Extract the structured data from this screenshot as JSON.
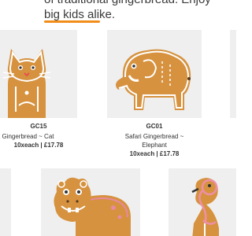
{
  "intro": {
    "line1": "of traditional gingerbread. Enjoy",
    "line2": "big kids alike."
  },
  "colors": {
    "accent": "#f28c1b",
    "card_bg": "#efefef",
    "text": "#333333",
    "gingerbread": "#d6923f",
    "icing": "#ffffff"
  },
  "products": [
    {
      "sku": "GC15",
      "name": "t Gingerbread ~ Cat",
      "price": "10xeach | £17.78",
      "icon": "gingerbread-cat-icon"
    },
    {
      "sku": "GC01",
      "name_line1": "Safari Gingerbread ~",
      "name_line2": "Elephant",
      "price": "10xeach | £17.78",
      "icon": "gingerbread-elephant-icon"
    },
    {
      "icon": "gingerbread-hippo-icon"
    },
    {
      "icon": "gingerbread-flamingo-icon"
    }
  ]
}
